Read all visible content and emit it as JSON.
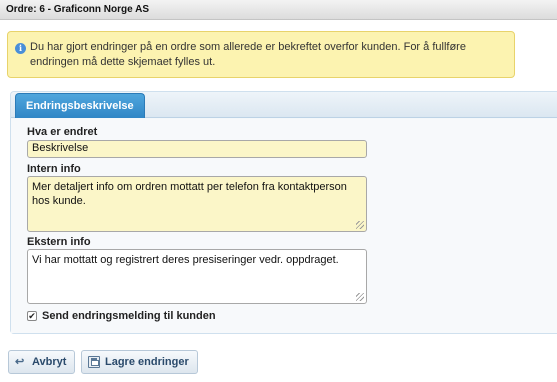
{
  "window": {
    "title": "Ordre: 6 - Graficonn Norge AS"
  },
  "info": {
    "icon": "info-icon",
    "message": "Du har gjort endringer på en ordre som allerede er bekreftet overfor kunden. For å fullføre endringen må dette skjemaet fylles ut."
  },
  "tabs": [
    {
      "label": "Endringsbeskrivelse",
      "active": true
    }
  ],
  "form": {
    "what_changed": {
      "label": "Hva er endret",
      "value": "Beskrivelse"
    },
    "internal_info": {
      "label": "Intern info",
      "value": "Mer detaljert info om ordren mottatt per telefon fra kontaktperson hos kunde."
    },
    "external_info": {
      "label": "Ekstern info",
      "value": "Vi har mottatt og registrert deres presiseringer vedr. oppdraget."
    },
    "send_notice": {
      "label": "Send endringsmelding til kunden",
      "checked": true
    }
  },
  "actions": {
    "cancel_label": "Avbryt",
    "save_label": "Lagre endringer"
  },
  "colors": {
    "info_background": "#fcf3b0",
    "tab_active": "#3b95d2",
    "field_highlight": "#fbf6c8"
  }
}
